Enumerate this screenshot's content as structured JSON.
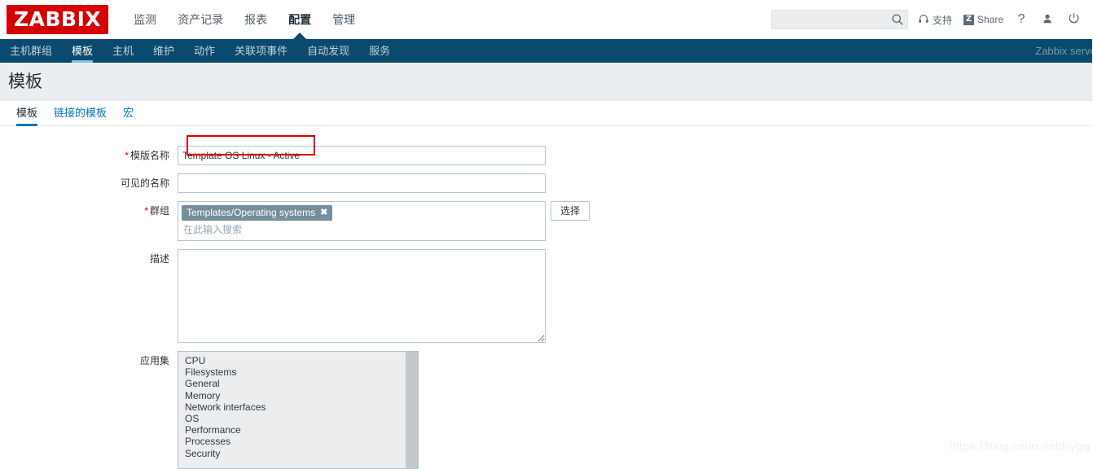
{
  "header": {
    "logo_text": "ZABBIX",
    "main_menu": [
      {
        "label": "监测",
        "active": false
      },
      {
        "label": "资产记录",
        "active": false
      },
      {
        "label": "报表",
        "active": false
      },
      {
        "label": "配置",
        "active": true
      },
      {
        "label": "管理",
        "active": false
      }
    ],
    "search": {
      "value": "",
      "placeholder": "",
      "icon": "search-icon"
    },
    "support_label": "支持",
    "support_icon": "headset-icon",
    "share_label": "Share",
    "share_badge": "Z",
    "help_label": "?",
    "user_icon": "user-icon",
    "signout_icon": "power-icon"
  },
  "subnav": {
    "items": [
      {
        "label": "主机群组",
        "active": false
      },
      {
        "label": "模板",
        "active": true
      },
      {
        "label": "主机",
        "active": false
      },
      {
        "label": "维护",
        "active": false
      },
      {
        "label": "动作",
        "active": false
      },
      {
        "label": "关联项事件",
        "active": false
      },
      {
        "label": "自动发现",
        "active": false
      },
      {
        "label": "服务",
        "active": false
      }
    ],
    "server_name": "Zabbix server"
  },
  "page": {
    "title": "模板"
  },
  "tabs": [
    {
      "label": "模板",
      "active": true
    },
    {
      "label": "链接的模板",
      "active": false
    },
    {
      "label": "宏",
      "active": false
    }
  ],
  "form": {
    "template_name": {
      "label": "模版名称",
      "required": true,
      "value": "Template OS Linux - Active",
      "placeholder": ""
    },
    "visible_name": {
      "label": "可见的名称",
      "required": false,
      "value": "",
      "placeholder": ""
    },
    "groups": {
      "label": "群组",
      "required": true,
      "chips": [
        "Templates/Operating systems"
      ],
      "chip_remove_icon": "✖",
      "placeholder": "在此输入搜索",
      "select_button": "选择"
    },
    "description": {
      "label": "描述",
      "required": false,
      "value": "",
      "placeholder": ""
    },
    "applications": {
      "label": "应用集",
      "options": [
        "CPU",
        "Filesystems",
        "General",
        "Memory",
        "Network interfaces",
        "OS",
        "Performance",
        "Processes",
        "Security"
      ]
    }
  },
  "watermark": "https://blog.csdn.net/lilygg",
  "colors": {
    "brand_red": "#d40000",
    "nav_blue": "#0a4a6e",
    "accent_blue": "#0275b8",
    "tab_underline": "#7cc2ef",
    "chip_bg": "#768d9b",
    "annotation_red": "#e00000",
    "band_gray": "#eaeef0"
  }
}
